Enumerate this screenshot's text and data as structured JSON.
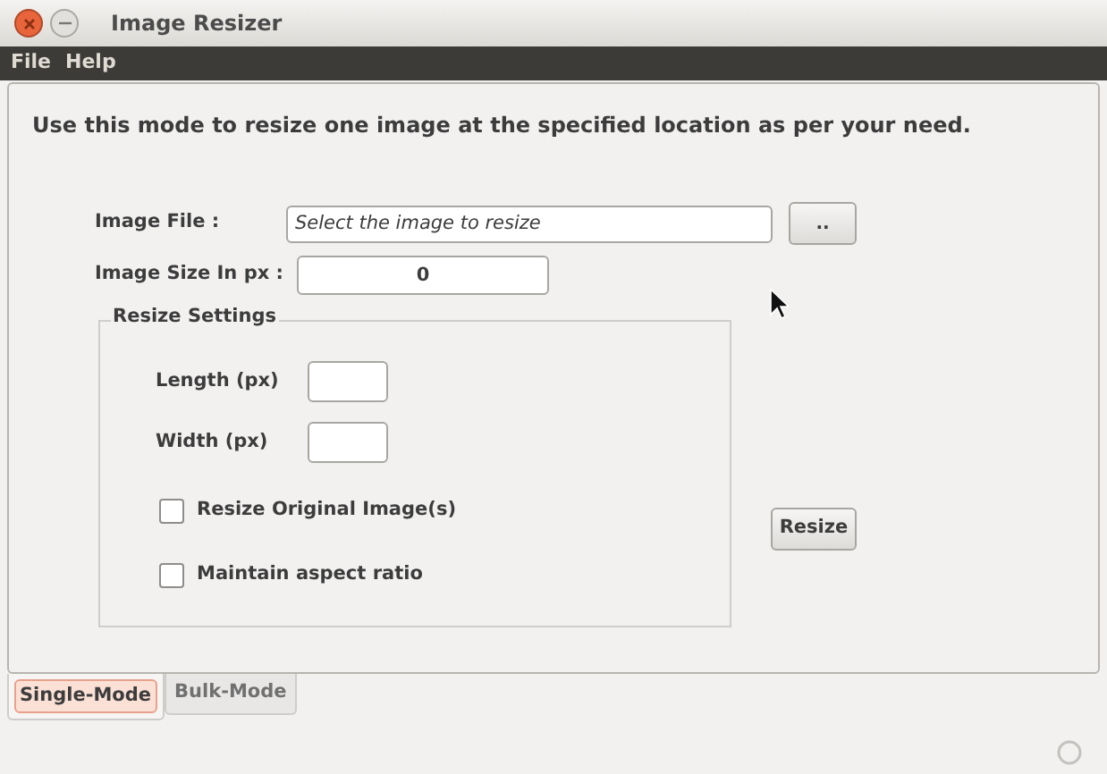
{
  "window": {
    "title": "Image Resizer"
  },
  "menu": [
    "File",
    "Help"
  ],
  "intro": "Use this mode to resize one image at the specified location as per your need.",
  "image_file": {
    "label": "Image File :",
    "placeholder": "Select the image to resize",
    "button": ".."
  },
  "image_size": {
    "label": "Image Size In px :",
    "value": "0"
  },
  "resize_settings": {
    "title": "Resize Settings",
    "fields": [
      {
        "label": "Length (px)"
      },
      {
        "label": "Width (px)"
      }
    ],
    "checkboxes": [
      {
        "label": "Resize Original Image(s)",
        "checked": false
      },
      {
        "label": "Maintain aspect ratio",
        "checked": false
      }
    ]
  },
  "resize_button": "Resize",
  "tabs": [
    {
      "label": "Single-Mode",
      "selected": true
    },
    {
      "label": "Bulk-Mode",
      "selected": false
    }
  ]
}
